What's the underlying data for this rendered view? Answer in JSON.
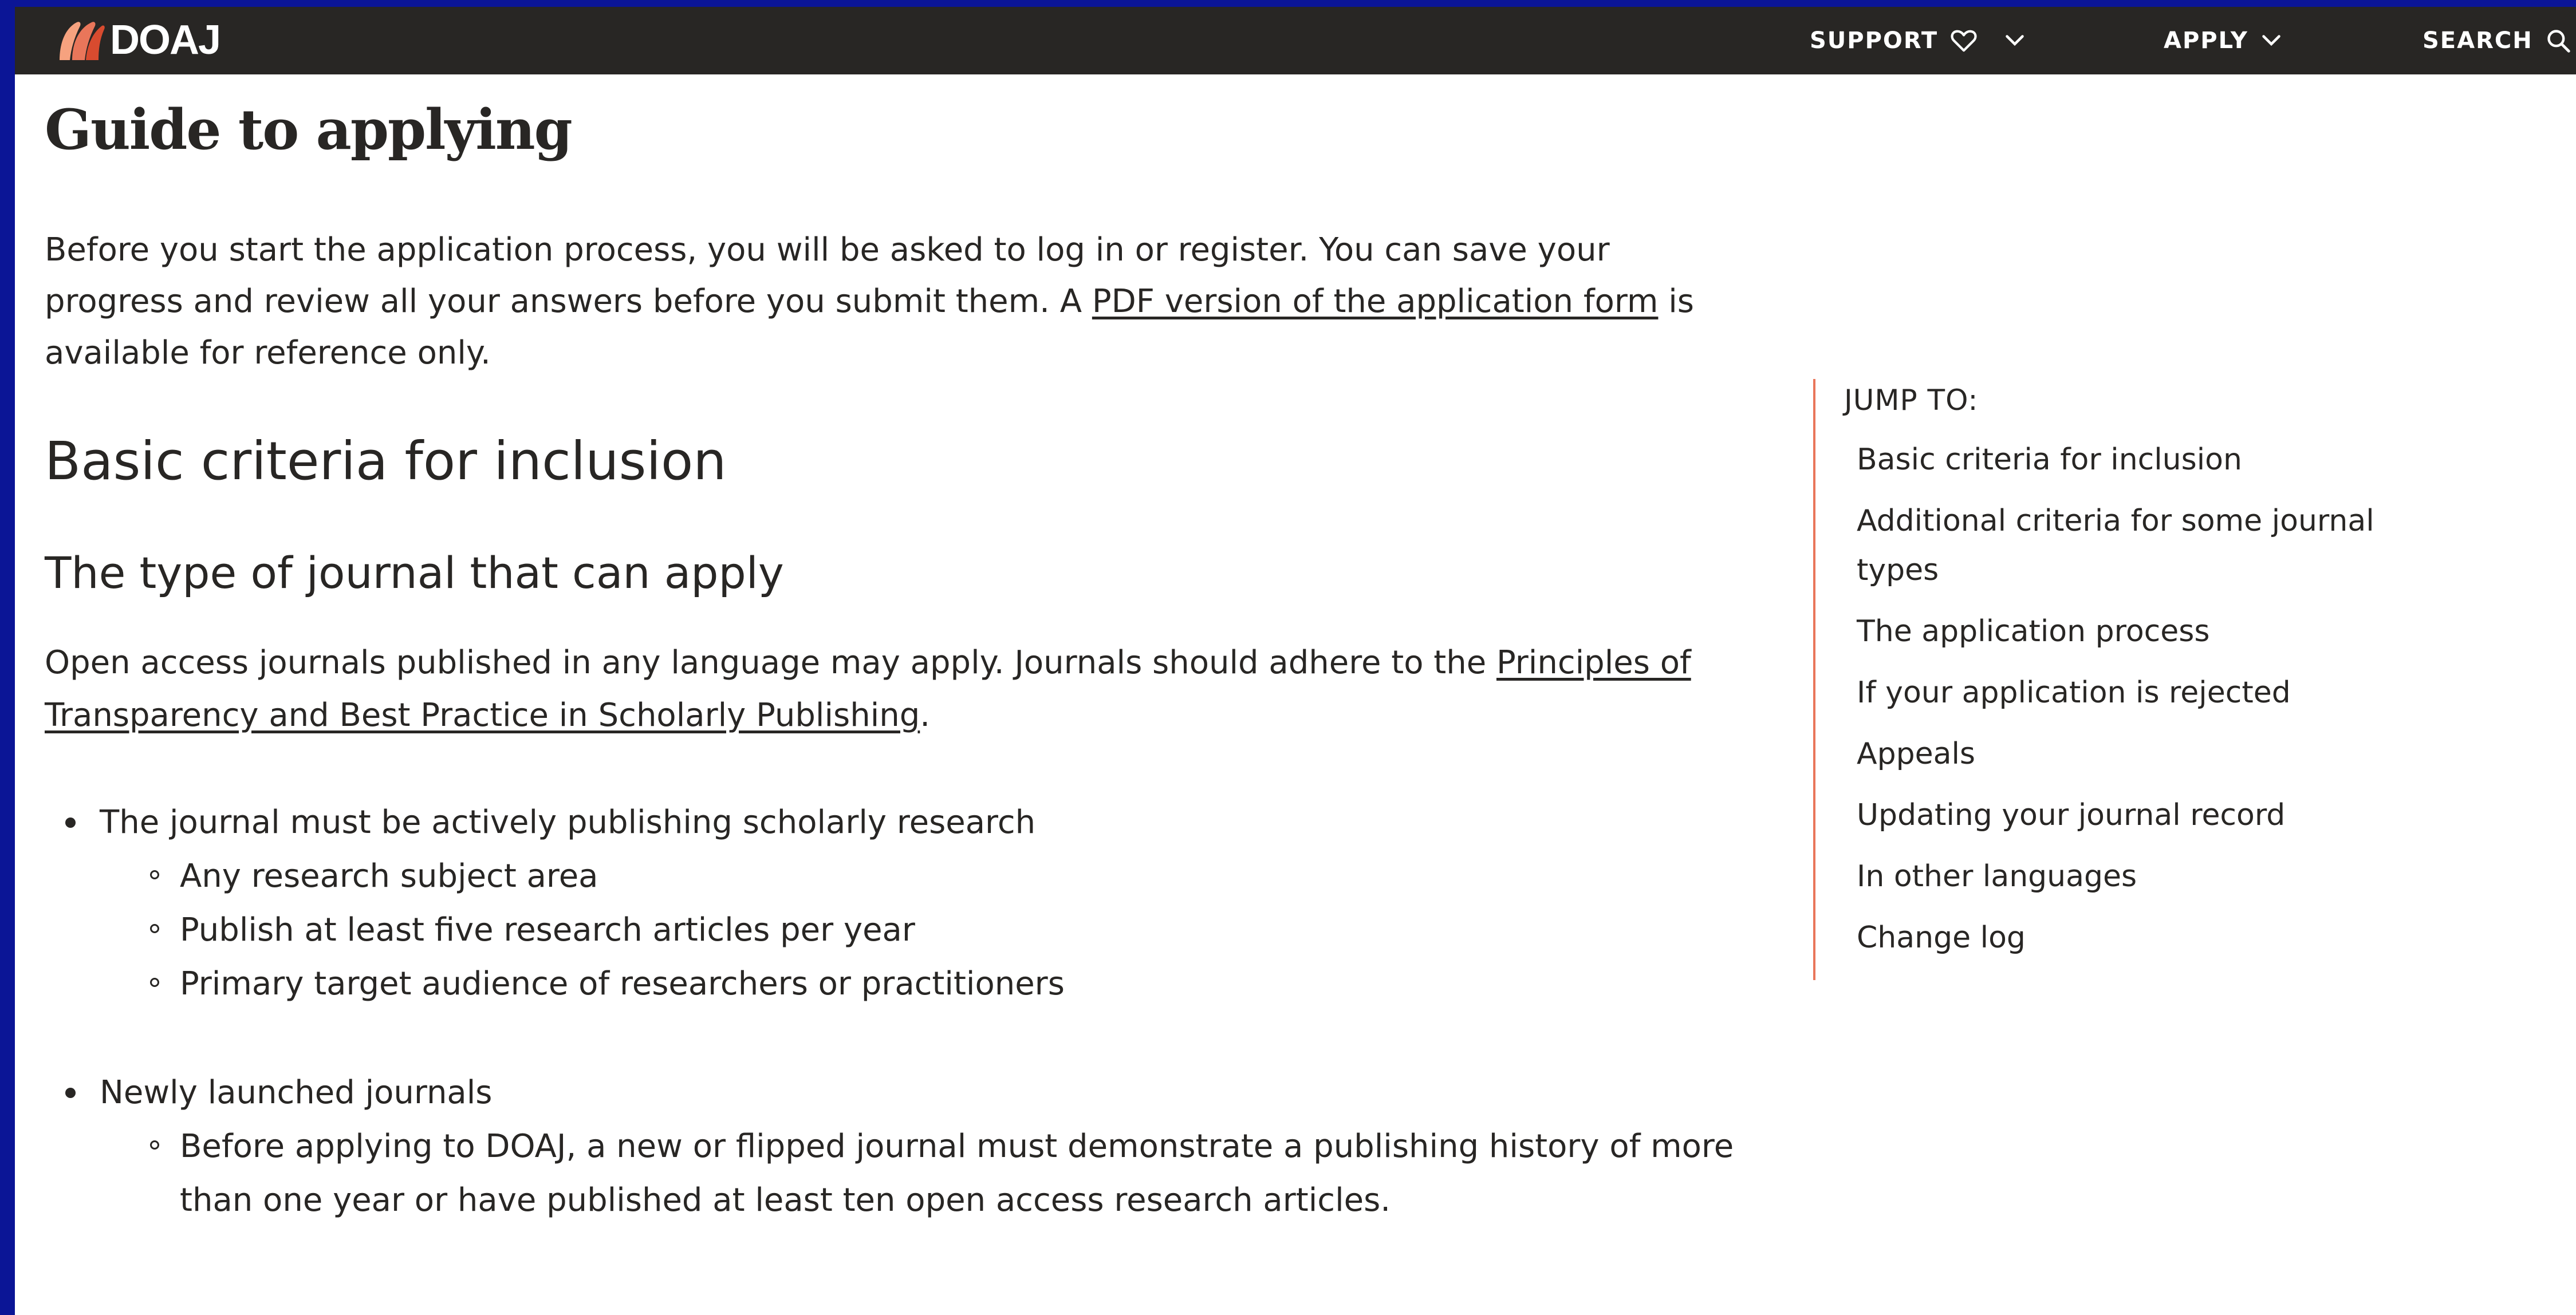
{
  "header": {
    "logo_text": "DOAJ",
    "nav": {
      "support": "SUPPORT",
      "apply": "APPLY",
      "search": "SEARCH"
    }
  },
  "main": {
    "title": "Guide to applying",
    "intro_before": "Before you start the application process, you will be asked to log in or register. You can save your progress and review all your answers before you submit them. A ",
    "intro_link": "PDF version of the application form",
    "intro_after": " is available for reference only.",
    "section_heading": "Basic criteria for inclusion",
    "subsection_heading": "The type of journal that can apply",
    "para_before": "Open access journals published in any language may apply. Journals should adhere to the ",
    "para_link": "Principles of Transparency and Best Practice in Scholarly Publishing",
    "para_after": ".",
    "criteria": [
      {
        "label": "The journal must be actively publishing scholarly research",
        "items": [
          "Any research subject area",
          "Publish at least five research articles per year",
          "Primary target audience of researchers or practitioners"
        ]
      },
      {
        "label": "Newly launched journals",
        "items": [
          "Before applying to DOAJ, a new or flipped journal must demonstrate a publishing history of more than one year or have published at least ten open access research articles."
        ]
      }
    ]
  },
  "toc": {
    "heading": "JUMP TO:",
    "items": [
      "Basic criteria for inclusion",
      "Additional criteria for some journal types",
      "The application process",
      "If your application is rejected",
      "Appeals",
      "Updating your journal record",
      "In other languages",
      "Change log"
    ]
  },
  "colors": {
    "topbar": "#282624",
    "accent": "#e9765a",
    "text": "#282624",
    "outer_border": "#0b1596"
  }
}
